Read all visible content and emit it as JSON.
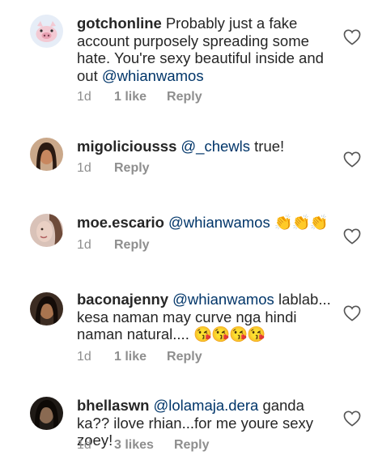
{
  "comments": [
    {
      "username": "gotchonline",
      "text": "Probably just a fake account purposely spreading some hate. You're sexy beautiful inside and out",
      "mention_after": "@whianwamos",
      "time": "1d",
      "likes": "1 like",
      "reply": "Reply",
      "avatar": "pig-avatar-icon"
    },
    {
      "username": "migoliciousss",
      "mention": "@_chewls",
      "text": "true!",
      "time": "1d",
      "reply": "Reply",
      "avatar": "user-photo"
    },
    {
      "username": "moe.escario",
      "mention": "@whianwamos",
      "text": "",
      "emoji": "👏👏👏",
      "time": "1d",
      "reply": "Reply",
      "avatar": "user-photo"
    },
    {
      "username": "baconajenny",
      "mention": "@whianwamos",
      "text": "lablab... kesa naman may curve nga hindi naman natural....",
      "emoji": "😘😘😘😘",
      "time": "1d",
      "likes": "1 like",
      "reply": "Reply",
      "avatar": "user-photo"
    },
    {
      "username": "bhellaswn",
      "mention": "@lolamaja.dera",
      "text": "ganda ka?? ilove rhian...for me youre sexy zoey!",
      "time": "1d",
      "likes": "3 likes",
      "reply": "Reply",
      "avatar": "user-photo"
    }
  ],
  "colors": {
    "text": "#262626",
    "mention": "#003569",
    "meta": "#8e8e8e"
  },
  "icons": {
    "like": "heart-outline-icon"
  }
}
